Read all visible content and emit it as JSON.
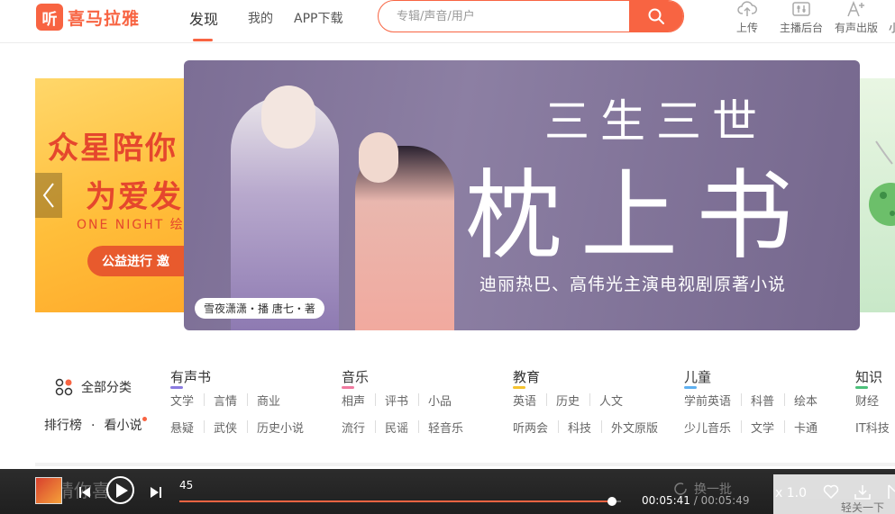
{
  "logo": {
    "mark": "听",
    "text": "喜马拉雅"
  },
  "nav": {
    "discover": "发现",
    "mine": "我的",
    "app_download": "APP下载"
  },
  "search": {
    "placeholder": "专辑/声音/用户"
  },
  "header_tools": [
    {
      "label": "上传",
      "icon": "upload-cloud-icon"
    },
    {
      "label": "主播后台",
      "icon": "mixer-icon"
    },
    {
      "label": "有声出版",
      "icon": "font-plus-icon"
    },
    {
      "label": "小"
    }
  ],
  "carousel": {
    "left_banner": {
      "line1": "众星陪你",
      "line2": "为爱发",
      "line3": "ONE NIGHT 绘",
      "button": "公益进行  邀"
    },
    "main_banner": {
      "title_top": "三生三世",
      "title_main": "枕上书",
      "subtitle": "迪丽热巴、高伟光主演电视剧原著小说",
      "credit": "雪夜潇潇・播    唐七・著"
    }
  },
  "categories": {
    "all_label": "全部分类",
    "ranking": "排行榜",
    "dot": "·",
    "novels": "看小说",
    "columns": [
      {
        "title": "有声书",
        "color": "#8a7be0",
        "row1": [
          "文学",
          "言情",
          "商业"
        ],
        "row2": [
          "悬疑",
          "武侠",
          "历史小说"
        ]
      },
      {
        "title": "音乐",
        "color": "#f07aa0",
        "row1": [
          "相声",
          "评书",
          "小品"
        ],
        "row2": [
          "流行",
          "民谣",
          "轻音乐"
        ]
      },
      {
        "title": "教育",
        "color": "#f5c330",
        "row1": [
          "英语",
          "历史",
          "人文"
        ],
        "row2": [
          "听两会",
          "科技",
          "外文原版"
        ]
      },
      {
        "title": "儿童",
        "color": "#5fb0f0",
        "row1": [
          "学前英语",
          "科普",
          "绘本"
        ],
        "row2": [
          "少儿音乐",
          "文学",
          "卡通"
        ]
      },
      {
        "title": "知识",
        "color": "#4cc07a",
        "row1": [
          "财经"
        ],
        "row2": [
          "IT科技"
        ]
      }
    ]
  },
  "player": {
    "behind_text": "猜你喜",
    "behind_refresh": "换一批",
    "behind_card_text": "轻关一下",
    "track_title": "45",
    "progress": 0.98,
    "current_time": "00:05:41",
    "total_time": "00:05:49",
    "speed": "x 1.0"
  }
}
